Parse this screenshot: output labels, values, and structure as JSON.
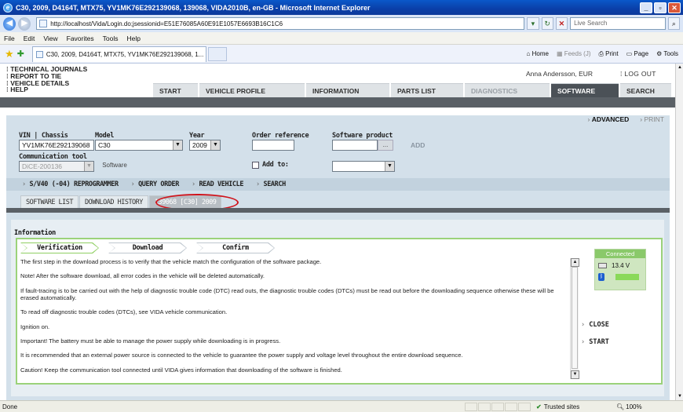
{
  "browser": {
    "title": "C30, 2009, D4164T, MTX75, YV1MK76E292139068, 139068, VIDA2010B, en-GB - Microsoft Internet Explorer",
    "url": "http://localhost/Vida/Login.do;jsessionid=E51E76085A60E91E1057E6693B16C1C6",
    "search_placeholder": "Live Search",
    "menu": [
      "File",
      "Edit",
      "View",
      "Favorites",
      "Tools",
      "Help"
    ],
    "tab_title": "C30, 2009, D4164T, MTX75, YV1MK76E292139068, 1...",
    "toolbar": {
      "home": "Home",
      "feeds": "Feeds (J)",
      "print": "Print",
      "page": "Page",
      "tools": "Tools"
    },
    "status": {
      "done": "Done",
      "zone": "Trusted sites",
      "zoom": "100%"
    }
  },
  "header": {
    "quicklinks": [
      "TECHNICAL JOURNALS",
      "REPORT TO TIE",
      "VEHICLE DETAILS",
      "HELP"
    ],
    "user": "Anna Andersson, EUR",
    "logout": "LOG OUT"
  },
  "nav": {
    "tabs": [
      "START",
      "VEHICLE PROFILE",
      "INFORMATION",
      "PARTS LIST",
      "DIAGNOSTICS",
      "SOFTWARE",
      "SEARCH"
    ],
    "active": "SOFTWARE",
    "disabled": "DIAGNOSTICS"
  },
  "mode": {
    "advanced": "ADVANCED",
    "print": "PRINT"
  },
  "form": {
    "vin_label": "VIN | Chassis",
    "vin_value": "YV1MK76E292139068",
    "model_label": "Model",
    "model_value": "C30",
    "year_label": "Year",
    "year_value": "2009",
    "order_label": "Order reference",
    "order_value": "",
    "product_label": "Software product",
    "product_value": "",
    "browse_label": "...",
    "add_label": "ADD",
    "comm_label": "Communication tool",
    "comm_value": "DiCE-200136",
    "software_btn": "Software",
    "add_to_label": "Add to:",
    "add_to_value": ""
  },
  "subnav": [
    "S/V40 (-04) REPROGRAMMER",
    "QUERY ORDER",
    "READ VEHICLE",
    "SEARCH"
  ],
  "subtabs": [
    "SOFTWARE LIST",
    "DOWNLOAD HISTORY",
    "139068 [C30] 2009"
  ],
  "info": {
    "title": "Information",
    "steps": [
      "Verification",
      "Download",
      "Confirm"
    ],
    "paragraphs": [
      "The first step in the download process is to verify that the vehicle match the configuration of the software package.",
      "Note! After the software download, all error codes in the vehicle will be deleted automatically.",
      "If fault-tracing is to be carried out with the help of diagnostic trouble code (DTC) read outs, the diagnostic trouble codes (DTCs) must be read out before the downloading sequence otherwise these will be erased automatically.",
      "To read off diagnostic trouble codes (DTCs), see VIDA vehicle communication.",
      "Ignition on.",
      "Important! The battery must be able to manage the power supply while downloading is in progress.",
      "It is recommended that an external power source is connected to the vehicle to guarantee the power supply and voltage level throughout the entire download sequence.",
      "Caution! Keep the communication tool connected until VIDA gives information that downloading of the software is finished."
    ],
    "connection": {
      "status": "Connected",
      "voltage": "13.4 V"
    },
    "close": "CLOSE",
    "start": "START"
  }
}
